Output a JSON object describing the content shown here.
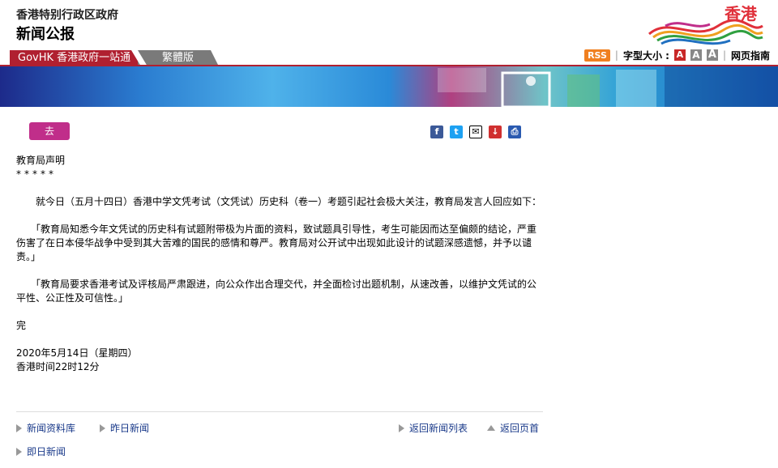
{
  "header": {
    "org": "香港特别行政区政府",
    "title": "新闻公报",
    "logo_text": "香港"
  },
  "tabs": {
    "govhk": "GovHK 香港政府一站通",
    "traditional": "繁體版"
  },
  "tools": {
    "rss": "RSS",
    "font_size_label": "字型大小 :",
    "font_a": "A",
    "page_guide": "网页指南"
  },
  "share": {
    "go_label": "去",
    "facebook": "f",
    "twitter": "t",
    "email": "✉",
    "download": "↓",
    "print": "⎙"
  },
  "article": {
    "heading": "教育局声明",
    "stars": "*****",
    "p1": "　　就今日（五月十四日）香港中学文凭考试（文凭试）历史科（卷一）考题引起社会极大关注，教育局发言人回应如下：",
    "p2": "　　「教育局知悉今年文凭试的历史科有试题附带极为片面的资料，致试题具引导性，考生可能因而达至偏颇的结论，严重伤害了在日本侵华战争中受到其大苦难的国民的感情和尊严。教育局对公开试中出现如此设计的试题深感遗憾，并予以谴责。」",
    "p3": "　　「教育局要求香港考试及评核局严肃跟进，向公众作出合理交代，并全面检讨出题机制，从速改善，以维护文凭试的公平性、公正性及可信性。」",
    "end": "完",
    "date": "2020年5月14日（星期四）",
    "time": "香港时间22时12分"
  },
  "footer_nav": {
    "archive": "新闻资料库",
    "yesterday": "昨日新闻",
    "back_list": "返回新闻列表",
    "back_top": "返回页首",
    "today": "即日新闻"
  }
}
